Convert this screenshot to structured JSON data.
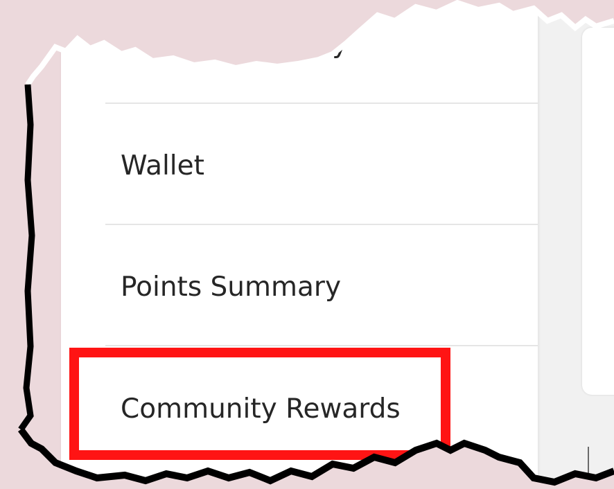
{
  "menu": {
    "items": [
      {
        "label": "Purchase History"
      },
      {
        "label": "Wallet"
      },
      {
        "label": "Points Summary"
      },
      {
        "label": "Community Rewards"
      }
    ]
  },
  "colors": {
    "background": "#ecd9dc",
    "highlight": "#ff1414",
    "text": "#262626",
    "divider": "#e5e5e5"
  }
}
